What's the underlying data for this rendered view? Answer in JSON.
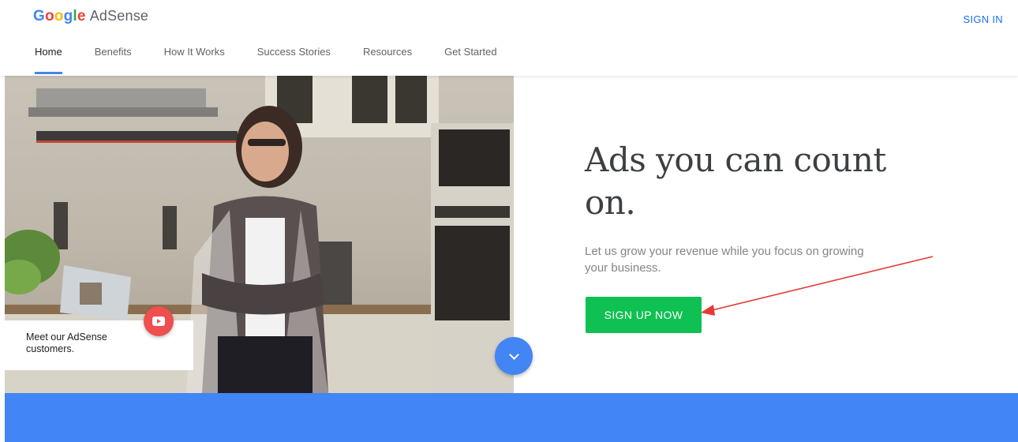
{
  "header": {
    "logo": {
      "letters": [
        "G",
        "o",
        "o",
        "g",
        "l",
        "e"
      ],
      "product": "AdSense"
    },
    "signin_label": "SIGN IN",
    "nav": [
      {
        "label": "Home",
        "active": true
      },
      {
        "label": "Benefits",
        "active": false
      },
      {
        "label": "How It Works",
        "active": false
      },
      {
        "label": "Success Stories",
        "active": false
      },
      {
        "label": "Resources",
        "active": false
      },
      {
        "label": "Get Started",
        "active": false
      }
    ]
  },
  "hero": {
    "video_card_text": "Meet our AdSense customers.",
    "headline": "Ads you can count on.",
    "subtext": "Let us grow your revenue while you focus on growing your business.",
    "cta_label": "SIGN UP NOW"
  },
  "colors": {
    "logo": [
      "#4285f4",
      "#ea4335",
      "#fbbc05",
      "#4285f4",
      "#34a853",
      "#ea4335"
    ],
    "accent_blue": "#4285f4",
    "cta_green": "#0fc152",
    "youtube_red": "#ef4f4f",
    "annotation_arrow": "#e53935"
  },
  "icons": {
    "video": "youtube-play-icon",
    "scroll": "chevron-down-icon"
  }
}
